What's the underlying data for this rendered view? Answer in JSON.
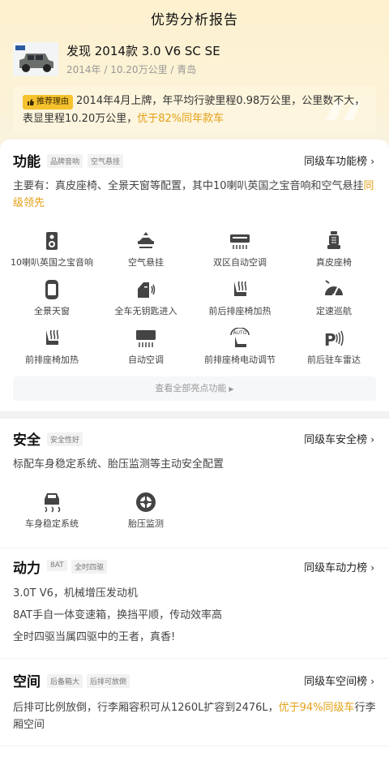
{
  "header": {
    "title": "优势分析报告"
  },
  "car": {
    "name": "发现 2014款 3.0 V6 SC SE",
    "meta": "2014年 / 10.20万公里 / 青岛"
  },
  "recommend": {
    "badge": "推荐理由",
    "text": "2014年4月上牌，年平均行驶里程0.98万公里，公里数不大，表显里程10.20万公里，",
    "highlight": "优于82%同年款车"
  },
  "function": {
    "title": "功能",
    "tags": [
      "品牌音响",
      "空气悬挂"
    ],
    "rank": "同级车功能榜",
    "desc": "主要有：真皮座椅、全景天窗等配置，其中10喇叭英国之宝音响和空气悬挂",
    "desc_highlight": "同级领先",
    "features": [
      {
        "label": "10喇叭英国之宝音响",
        "icon": "speaker-icon"
      },
      {
        "label": "空气悬挂",
        "icon": "air-suspension-icon"
      },
      {
        "label": "双区自动空调",
        "icon": "dual-zone-ac-icon"
      },
      {
        "label": "真皮座椅",
        "icon": "leather-seat-icon"
      },
      {
        "label": "全景天窗",
        "icon": "panoramic-sunroof-icon"
      },
      {
        "label": "全车无钥匙进入",
        "icon": "keyless-entry-icon"
      },
      {
        "label": "前后排座椅加热",
        "icon": "seat-heating-icon"
      },
      {
        "label": "定速巡航",
        "icon": "cruise-control-icon"
      },
      {
        "label": "前排座椅加热",
        "icon": "front-seat-heating-icon"
      },
      {
        "label": "自动空调",
        "icon": "auto-ac-icon"
      },
      {
        "label": "前排座椅电动调节",
        "icon": "power-seat-icon"
      },
      {
        "label": "前后驻车雷达",
        "icon": "parking-radar-icon"
      }
    ],
    "more": "查看全部亮点功能"
  },
  "safety": {
    "title": "安全",
    "tags": [
      "安全性好"
    ],
    "rank": "同级车安全榜",
    "desc": "标配车身稳定系统、胎压监测等主动安全配置",
    "features": [
      {
        "label": "车身稳定系统",
        "icon": "stability-control-icon"
      },
      {
        "label": "胎压监测",
        "icon": "tire-pressure-icon"
      }
    ]
  },
  "power": {
    "title": "动力",
    "tags": [
      "8AT",
      "全时四驱"
    ],
    "rank": "同级车动力榜",
    "lines": [
      "3.0T V6，机械增压发动机",
      "8AT手自一体变速箱，换挡平顺，传动效率高",
      "全时四驱当属四驱中的王者，真香!"
    ]
  },
  "space": {
    "title": "空间",
    "tags": [
      "后备箱大",
      "后排可放倒"
    ],
    "rank": "同级车空间榜",
    "desc": "后排可比例放倒，行李厢容积可从1260L扩容到2476L，",
    "desc_highlight": "优于94%同级车",
    "desc_tail": "行李厢空间"
  },
  "colors": {
    "accent": "#e3a016",
    "badge": "#f5c22e"
  }
}
